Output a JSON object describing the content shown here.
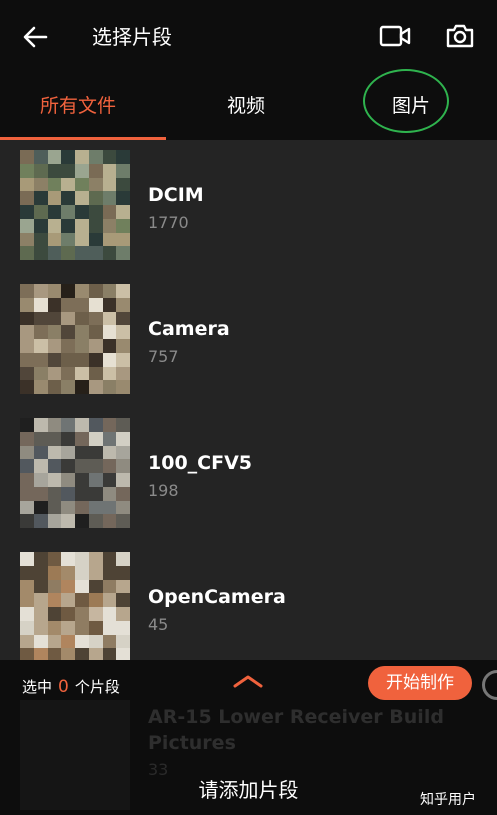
{
  "header": {
    "title": "选择片段",
    "back_icon": "arrow-left-icon",
    "video_icon": "video-camera-icon",
    "camera_icon": "photo-camera-icon"
  },
  "tabs": [
    {
      "label": "所有文件",
      "active": true
    },
    {
      "label": "视频",
      "active": false
    },
    {
      "label": "图片",
      "active": false
    }
  ],
  "folders": [
    {
      "name": "DCIM",
      "count": "1770"
    },
    {
      "name": "Camera",
      "count": "757"
    },
    {
      "name": "100_CFV5",
      "count": "198"
    },
    {
      "name": "OpenCamera",
      "count": "45"
    },
    {
      "name": "AR-15 Lower Receiver Build Pictures",
      "count": "33"
    }
  ],
  "selection": {
    "prefix": "选中",
    "count": "0",
    "suffix": "个片段",
    "start_button": "开始制作",
    "add_label": "请添加片段"
  },
  "watermark": "知乎用户",
  "colors": {
    "accent": "#f0623d",
    "annotation_circle": "#2fb34e"
  }
}
